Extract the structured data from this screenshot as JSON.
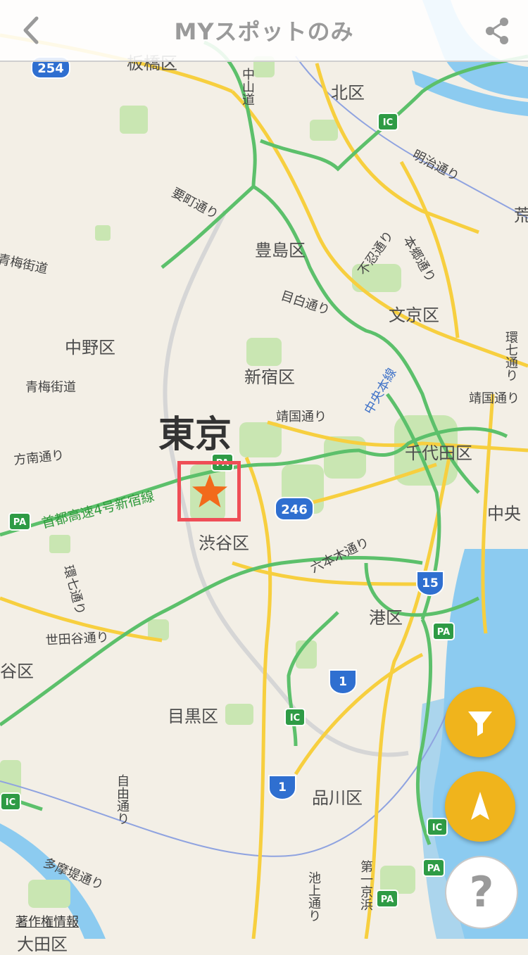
{
  "header": {
    "title": "MYスポットのみ"
  },
  "icons": {
    "back": "chevron-left-icon",
    "share": "share-icon",
    "filter": "funnel-icon",
    "locate": "navigation-arrow-icon",
    "marker": "star-icon"
  },
  "colors": {
    "accent": "#f0b41c",
    "marker": "#f26a1b",
    "highlight": "#ef4e57",
    "water": "#8ccbf0",
    "green_road": "#5cc06b",
    "yellow_road": "#f7cf3f"
  },
  "map": {
    "city": "東京",
    "districts": [
      "板橋区",
      "北区",
      "豊島区",
      "文京区",
      "中野区",
      "新宿区",
      "千代田区",
      "渋谷区",
      "中央",
      "港区",
      "谷区",
      "目黒区",
      "品川区",
      "荒"
    ],
    "roads": [
      "中山道",
      "明治通り",
      "要町通り",
      "青梅街道",
      "本郷通り",
      "不忍通り",
      "目白通り",
      "靖国通り",
      "青梅街道",
      "方南通り",
      "環七通り",
      "世田谷通り",
      "六本木通り",
      "自由通り",
      "多摩堤通り",
      "池上通り",
      "第一京浜",
      "環七通り",
      "靖国通り"
    ],
    "rail": "中央本線",
    "expressway": "首都高速4号新宿線",
    "route_numbers": [
      "254",
      "246",
      "15",
      "1",
      "1"
    ],
    "ic_labels": [
      "IC",
      "IC",
      "IC",
      "IC"
    ],
    "pa_labels": [
      "PA",
      "PA",
      "PA",
      "PA",
      "PA"
    ],
    "copyright": "著作権情報",
    "bottom_cut": "大田区"
  },
  "help": {
    "label": "?"
  }
}
